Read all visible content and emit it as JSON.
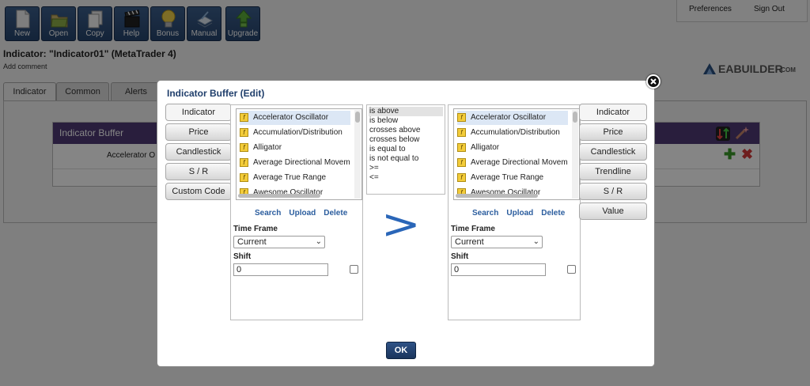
{
  "toolbar": [
    {
      "label": "New",
      "icon": "new-page-icon"
    },
    {
      "label": "Open",
      "icon": "folder-icon"
    },
    {
      "label": "Copy",
      "icon": "copy-icon"
    },
    {
      "label": "Help",
      "icon": "clapperboard-icon"
    },
    {
      "label": "Bonus",
      "icon": "bulb-icon"
    },
    {
      "label": "Manual",
      "icon": "manual-icon"
    },
    {
      "label": "Upgrade",
      "icon": "upgrade-arrow-icon"
    }
  ],
  "topright": {
    "preferences": "Preferences",
    "signout": "Sign Out"
  },
  "page": {
    "title": "Indicator: \"Indicator01\" (MetaTrader 4)",
    "add_comment": "Add comment"
  },
  "logo": {
    "text": "EABUILDER",
    "suffix": ".COM"
  },
  "tabs": [
    "Indicator",
    "Common",
    "Alerts"
  ],
  "background_panel": {
    "header": "Indicator Buffer",
    "row_text": "Accelerator O"
  },
  "dialog": {
    "title": "Indicator Buffer (Edit)",
    "left_buttons": [
      "Indicator",
      "Price",
      "Candlestick",
      "S / R",
      "Custom Code"
    ],
    "right_buttons": [
      "Indicator",
      "Price",
      "Candlestick",
      "Trendline",
      "S / R",
      "Value"
    ],
    "indicators": [
      "Accelerator Oscillator",
      "Accumulation/Distribution",
      "Alligator",
      "Average Directional Movement",
      "Average True Range",
      "Awesome Oscillator"
    ],
    "links": {
      "search": "Search",
      "upload": "Upload",
      "delete": "Delete"
    },
    "timeframe_label": "Time Frame",
    "timeframe_value": "Current",
    "shift_label": "Shift",
    "shift_value": "0",
    "operators": [
      "is above",
      "is below",
      "crosses above",
      "crosses below",
      "is equal to",
      "is not equal to",
      ">=",
      "<="
    ],
    "selected_operator_symbol": ">",
    "ok_label": "OK"
  },
  "colors": {
    "toolbar": "#2f5080",
    "header_purple": "#4f3a75",
    "link": "#2b5d9e",
    "ok_button": "#1e3a63"
  }
}
